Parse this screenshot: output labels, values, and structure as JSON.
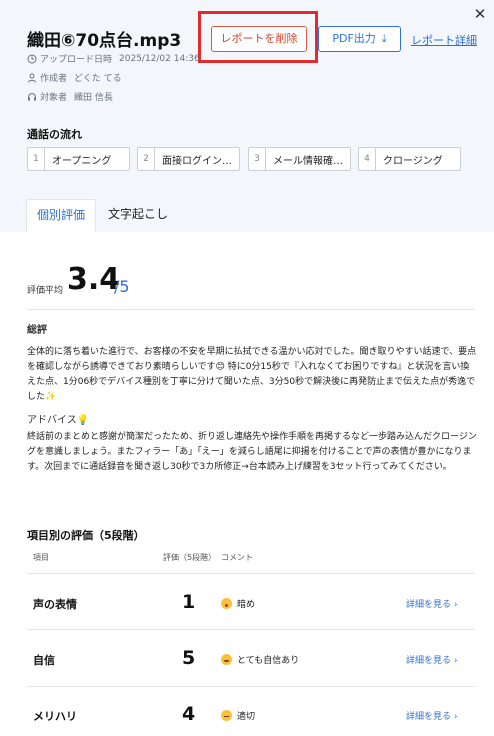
{
  "header": {
    "title": "織田⑥70点台.mp3",
    "delete_label": "レポートを削除",
    "pdf_label": "PDF出力",
    "detail_link": "レポート詳細",
    "close_icon": "close-icon"
  },
  "meta": {
    "upload_label": "アップロード日時",
    "upload_value": "2025/12/02 14:36",
    "creator_label": "作成者",
    "creator_value": "どくた てる",
    "target_label": "対象者",
    "target_value": "織田 信長"
  },
  "flow": {
    "title": "通話の流れ",
    "steps": [
      {
        "num": "1",
        "label": "オープニング"
      },
      {
        "num": "2",
        "label": "面接ログイント…"
      },
      {
        "num": "3",
        "label": "メール情報確認…"
      },
      {
        "num": "4",
        "label": "クロージング"
      }
    ]
  },
  "tabs": [
    {
      "label": "個別評価",
      "active": true
    },
    {
      "label": "文字起こし",
      "active": false
    }
  ],
  "score": {
    "label": "評価平均",
    "value": "3.4",
    "max": "/5"
  },
  "summary": {
    "heading": "総評",
    "text": "全体的に落ち着いた進行で、お客様の不安を早期に払拭できる温かい応対でした。聞き取りやすい話速で、要点を確認しながら誘導できており素晴らしいです😊 特に0分15秒で『入れなくてお困りですね』と状況を言い換えた点、1分06秒でデバイス種別を丁寧に分けて聞いた点、3分50秒で解決後に再発防止まで伝えた点が秀逸でした✨",
    "advice_heading": "アドバイス💡",
    "advice_text": "終話前のまとめと感謝が簡潔だったため、折り返し連絡先や操作手順を再掲するなど一歩踏み込んだクロージングを意識しましょう。またフィラー「あ」「えー」を減らし語尾に抑揚を付けることで声の表情が豊かになります。次回までに通話録音を聞き返し30秒で3カ所修正→台本読み上げ練習を3セット行ってみてください。"
  },
  "evaluation": {
    "title": "項目別の評価（5段階）",
    "col_item": "項目",
    "col_score": "評価（5段階）",
    "col_comment": "コメント",
    "rows": [
      {
        "name": "声の表情",
        "score": "1",
        "comment": "暗め",
        "emoji": "shock",
        "link": "詳細を見る ›"
      },
      {
        "name": "自信",
        "score": "5",
        "comment": "とても自信あり",
        "emoji": "grin",
        "link": "詳細を見る ›"
      },
      {
        "name": "メリハリ",
        "score": "4",
        "comment": "適切",
        "emoji": "neutral",
        "link": "詳細を見る ›"
      }
    ]
  },
  "colors": {
    "accent": "#2f6fd6",
    "delete": "#d2452a",
    "highlight": "#e22b2b",
    "header_bg": "#f3f6fa"
  }
}
